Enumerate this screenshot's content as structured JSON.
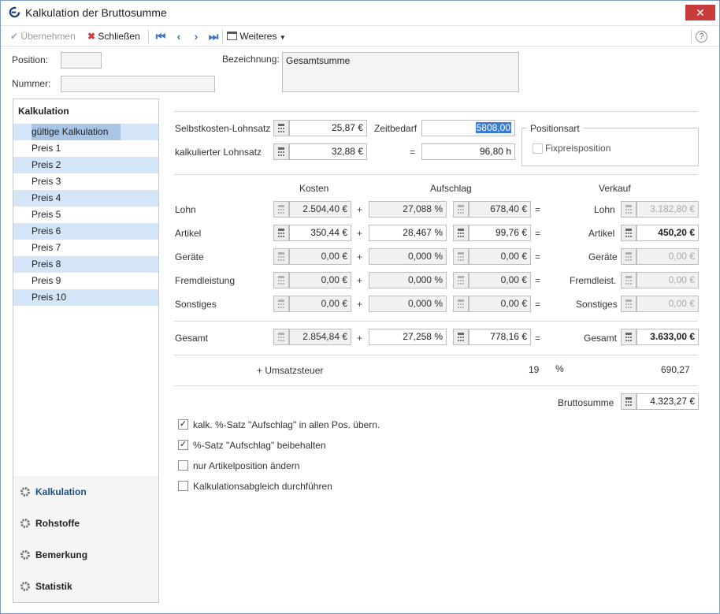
{
  "window": {
    "title": "Kalkulation der Bruttosumme",
    "close": "✕"
  },
  "toolbar": {
    "accept": "Übernehmen",
    "close": "Schließen",
    "more": "Weiteres",
    "help": "?"
  },
  "header": {
    "position_label": "Position:",
    "position_value": "",
    "number_label": "Nummer:",
    "number_value": "",
    "designation_label": "Bezeichnung:",
    "designation_value": "Gesamtsumme"
  },
  "sidebar": {
    "heading": "Kalkulation",
    "items": [
      "gültige Kalkulation",
      "Preis 1",
      "Preis 2",
      "Preis 3",
      "Preis 4",
      "Preis 5",
      "Preis 6",
      "Preis 7",
      "Preis 8",
      "Preis 9",
      "Preis 10"
    ],
    "nav": [
      "Kalkulation",
      "Rohstoffe",
      "Bemerkung",
      "Statistik"
    ]
  },
  "rates": {
    "cost_rate_label": "Selbstkosten-Lohnsatz",
    "cost_rate": "25,87 €",
    "calc_rate_label": "kalkulierter Lohnsatz",
    "calc_rate": "32,88 €",
    "time_label": "Zeitbedarf",
    "time_value": "5808,00",
    "equals": "=",
    "time_result": "96,80 h"
  },
  "position_type": {
    "legend": "Positionsart",
    "fixed_price_label": "Fixpreisposition",
    "fixed_price_checked": false
  },
  "columns": {
    "costs": "Kosten",
    "markup": "Aufschlag",
    "sale": "Verkauf"
  },
  "rows": [
    {
      "label": "Lohn",
      "cost": "2.504,40 €",
      "pct": "27,088 %",
      "markup": "678,40 €",
      "sale_label": "Lohn",
      "sale": "3.182,80 €"
    },
    {
      "label": "Artikel",
      "cost": "350,44 €",
      "pct": "28,467 %",
      "markup": "99,76 €",
      "sale_label": "Artikel",
      "sale": "450,20 €"
    },
    {
      "label": "Geräte",
      "cost": "0,00 €",
      "pct": "0,000 %",
      "markup": "0,00 €",
      "sale_label": "Geräte",
      "sale": "0,00 €"
    },
    {
      "label": "Fremdleistung",
      "cost": "0,00 €",
      "pct": "0,000 %",
      "markup": "0,00 €",
      "sale_label": "Fremdleist.",
      "sale": "0,00 €"
    },
    {
      "label": "Sonstiges",
      "cost": "0,00 €",
      "pct": "0,000 %",
      "markup": "0,00 €",
      "sale_label": "Sonstiges",
      "sale": "0,00 €"
    }
  ],
  "ops": {
    "plus": "+",
    "equals": "="
  },
  "total": {
    "label": "Gesamt",
    "cost": "2.854,84 €",
    "pct": "27,258 %",
    "markup": "778,16 €",
    "sale_label": "Gesamt",
    "sale": "3.633,00 €"
  },
  "vat": {
    "label": "+ Umsatzsteuer",
    "rate": "19",
    "unit": "%",
    "amount": "690,27"
  },
  "gross": {
    "label": "Bruttosumme",
    "value": "4.323,27 €"
  },
  "options": [
    {
      "label": "kalk. %-Satz \"Aufschlag\" in allen Pos. übern.",
      "checked": true
    },
    {
      "label": "%-Satz \"Aufschlag\" beibehalten",
      "checked": true
    },
    {
      "label": "nur Artikelposition ändern",
      "checked": false
    },
    {
      "label": "Kalkulationsabgleich durchführen",
      "checked": false
    }
  ],
  "colors": {
    "accent": "#3c73c2",
    "close_red": "#c93c3c",
    "selection": "#a9c5e6",
    "alt_row": "#d3e5f6"
  }
}
